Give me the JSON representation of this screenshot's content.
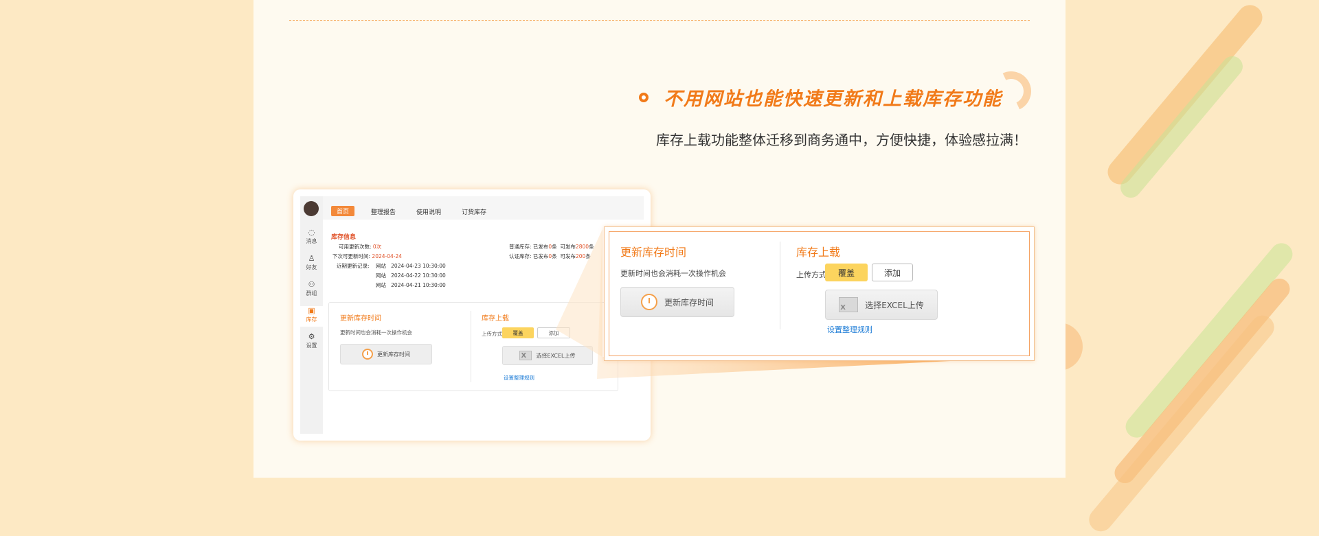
{
  "colors": {
    "accent": "#f17a19",
    "highlight": "#e0532a",
    "link": "#1b7bd6",
    "yellow_button": "#fcd45e",
    "background": "#fde9c4",
    "card": "#fefaf0"
  },
  "feature": {
    "title": "不用网站也能快速更新和上载库存功能",
    "subtitle": "库存上载功能整体迁移到商务通中，方便快捷，体验感拉满！"
  },
  "mini_app": {
    "sidebar": [
      {
        "label": "消息",
        "icon": "chat-bubble-icon"
      },
      {
        "label": "好友",
        "icon": "user-icon"
      },
      {
        "label": "群组",
        "icon": "group-icon"
      },
      {
        "label": "库存",
        "icon": "inventory-icon",
        "active": true
      },
      {
        "label": "设置",
        "icon": "settings-icon"
      }
    ],
    "tabs": [
      "首页",
      "整理报告",
      "使用说明",
      "订货库存"
    ],
    "section_title": "库存信息",
    "info": {
      "remaining_label": "可用更新次数:",
      "remaining_value": "0次",
      "next_time_label": "下次可更新时间:",
      "next_time_value": "2024-04-24",
      "recent_label": "近期更新记录:",
      "records": [
        {
          "source": "网站",
          "time": "2024-04-23 10:30:00"
        },
        {
          "source": "网站",
          "time": "2024-04-22 10:30:00"
        },
        {
          "source": "网站",
          "time": "2024-04-21 10:30:00"
        }
      ],
      "normal_stock_label": "普通库存:",
      "normal_published_prefix": "已发布",
      "normal_published": "0",
      "normal_published_suffix": "条",
      "normal_allowed_prefix": "可发布",
      "normal_allowed": "2800",
      "normal_allowed_suffix": "条",
      "cert_stock_label": "认证库存:",
      "cert_published_prefix": "已发布",
      "cert_published": "0",
      "cert_published_suffix": "条",
      "cert_allowed_prefix": "可发布",
      "cert_allowed": "200",
      "cert_allowed_suffix": "条"
    }
  },
  "panel": {
    "refresh_title": "更新库存时间",
    "refresh_desc": "更新时间也会消耗一次操作机会",
    "refresh_button": "更新库存时间",
    "upload_title": "库存上载",
    "upload_mode_label": "上传方式",
    "mode_overwrite": "覆盖",
    "mode_add": "添加",
    "excel_button": "选择EXCEL上传",
    "rules_link": "设置整理规则"
  }
}
